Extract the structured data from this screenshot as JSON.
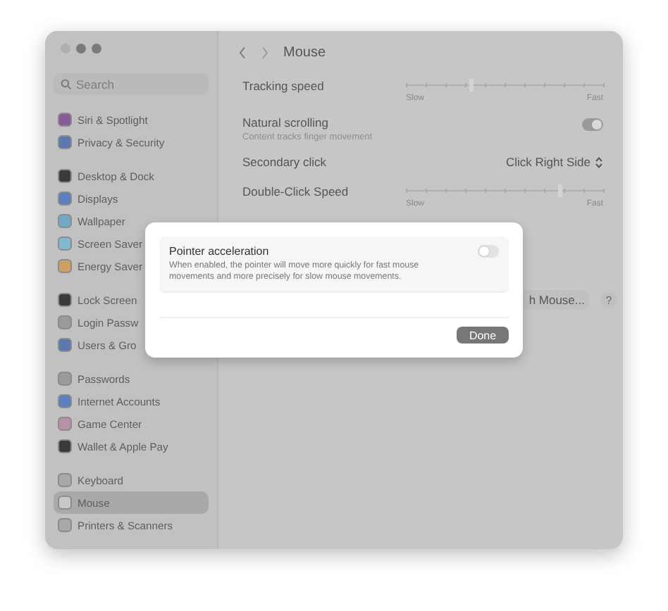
{
  "window": {
    "title": "Mouse"
  },
  "search": {
    "placeholder": "Search"
  },
  "sidebar": {
    "groups": [
      {
        "items": [
          {
            "label": "Siri & Spotlight",
            "color": "#8a5a9a",
            "selected": false
          },
          {
            "label": "Privacy & Security",
            "color": "#5a78b0",
            "selected": false
          }
        ]
      },
      {
        "items": [
          {
            "label": "Desktop & Dock",
            "color": "#3a3a3a",
            "selected": false
          },
          {
            "label": "Displays",
            "color": "#5a80c0",
            "selected": false
          },
          {
            "label": "Wallpaper",
            "color": "#70a8c8",
            "selected": false
          },
          {
            "label": "Screen Saver",
            "color": "#80b8d0",
            "selected": false
          },
          {
            "label": "Energy Saver",
            "color": "#d0a060",
            "selected": false
          }
        ]
      },
      {
        "items": [
          {
            "label": "Lock Screen",
            "color": "#3a3a3a",
            "selected": false
          },
          {
            "label": "Login Passw",
            "color": "#9a9a9a",
            "selected": false
          },
          {
            "label": "Users & Gro",
            "color": "#5a78b0",
            "selected": false
          }
        ]
      },
      {
        "items": [
          {
            "label": "Passwords",
            "color": "#9a9a9a",
            "selected": false
          },
          {
            "label": "Internet Accounts",
            "color": "#5a80c0",
            "selected": false
          },
          {
            "label": "Game Center",
            "color": "#b890a8",
            "selected": false
          },
          {
            "label": "Wallet & Apple Pay",
            "color": "#3a3a3a",
            "selected": false
          }
        ]
      },
      {
        "items": [
          {
            "label": "Keyboard",
            "color": "#a8a8a8",
            "selected": false
          },
          {
            "label": "Mouse",
            "color": "#c8c8c8",
            "selected": true
          },
          {
            "label": "Printers & Scanners",
            "color": "#a8a8a8",
            "selected": false
          }
        ]
      }
    ]
  },
  "settings": [
    {
      "kind": "slider",
      "label": "Tracking speed",
      "level": 0.33,
      "min_label": "Slow",
      "max_label": "Fast"
    },
    {
      "kind": "toggle",
      "label": "Natural scrolling",
      "subtitle": "Content tracks finger movement",
      "on": true
    },
    {
      "kind": "select",
      "label": "Secondary click",
      "value": "Click Right Side"
    },
    {
      "kind": "slider",
      "label": "Double-Click Speed",
      "level": 0.78,
      "min_label": "Slow",
      "max_label": "Fast"
    }
  ],
  "footer": {
    "button": "h Mouse...",
    "help": "?"
  },
  "dialog": {
    "title": "Pointer acceleration",
    "description": "When enabled, the pointer will move more quickly for fast mouse movements and more precisely for slow mouse movements.",
    "on": false,
    "button": "Done"
  }
}
